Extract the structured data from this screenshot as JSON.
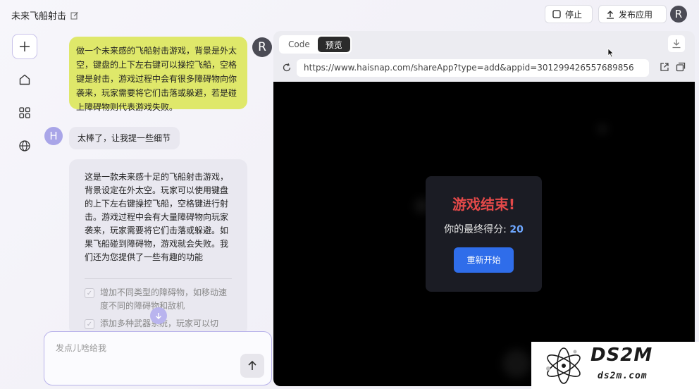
{
  "app": {
    "title": "未来飞船射击"
  },
  "topbar": {
    "stop_label": "停止",
    "publish_label": "发布应用",
    "avatar_letter": "R"
  },
  "chat": {
    "user_message": "做一个未来感的飞船射击游戏，背景是外太空，键盘的上下左右键可以操控飞船，空格键是射击，游戏过程中会有很多障碍物向你袭来，玩家需要将它们击落或躲避，若是碰上障碍物则代表游戏失败。",
    "user_avatar": "R",
    "bot_avatar": "H",
    "bot_short": "太棒了，让我提一些细节",
    "bot_long": "这是一款未来感十足的飞船射击游戏，背景设定在外太空。玩家可以使用键盘的上下左右键操控飞船，空格键进行射击。游戏过程中会有大量障碍物向玩家袭来，玩家需要将它们击落或躲避。如果飞船碰到障碍物，游戏就会失败。我们还为您提供了一些有趣的功能",
    "features": [
      "增加不同类型的障碍物，如移动速度不同的障碍物和敌机",
      "添加多种武器系统，玩家可以切"
    ],
    "input_placeholder": "发点儿啥给我"
  },
  "preview": {
    "tabs": [
      {
        "label": "Code",
        "active": false
      },
      {
        "label": "预览",
        "active": true
      }
    ],
    "url": "https://www.haisnap.com/shareApp?type=add&appid=301299426557689856",
    "game_over_title": "游戏结束!",
    "score_label": "你的最终得分:",
    "score_value": "20",
    "restart_label": "重新开始"
  },
  "watermark": {
    "top": "DS2M",
    "bottom": "ds2m.com"
  },
  "colors": {
    "accent": "#2f6dea",
    "user_bubble": "#dfe86a",
    "game_over": "#e44949"
  }
}
